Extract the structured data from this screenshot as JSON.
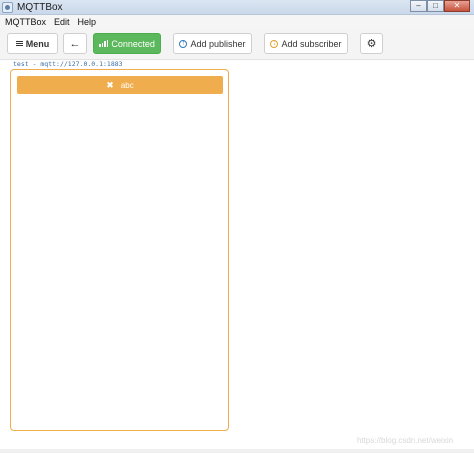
{
  "window": {
    "title": "MQTTBox",
    "minimize_symbol": "–",
    "maximize_symbol": "□",
    "close_symbol": "✕"
  },
  "menubar": {
    "items": [
      {
        "label": "MQTTBox"
      },
      {
        "label": "Edit"
      },
      {
        "label": "Help"
      }
    ]
  },
  "toolbar": {
    "menu_label": "Menu",
    "back_symbol": "←",
    "connected_label": "Connected",
    "add_publisher_label": "Add publisher",
    "add_subscriber_label": "Add subscriber",
    "settings_symbol": "⚙",
    "colors": {
      "connected_bg": "#5cb85c",
      "publisher_icon": "#337ab7",
      "subscriber_icon": "#e0a030"
    }
  },
  "connection": {
    "label": "test - mqtt://127.0.0.1:1883"
  },
  "subscribers": [
    {
      "topic": "abc",
      "close_symbol": "✖",
      "color": "#f0ad4e"
    }
  ],
  "watermark": {
    "text": "https://blog.csdn.net/weixin"
  }
}
